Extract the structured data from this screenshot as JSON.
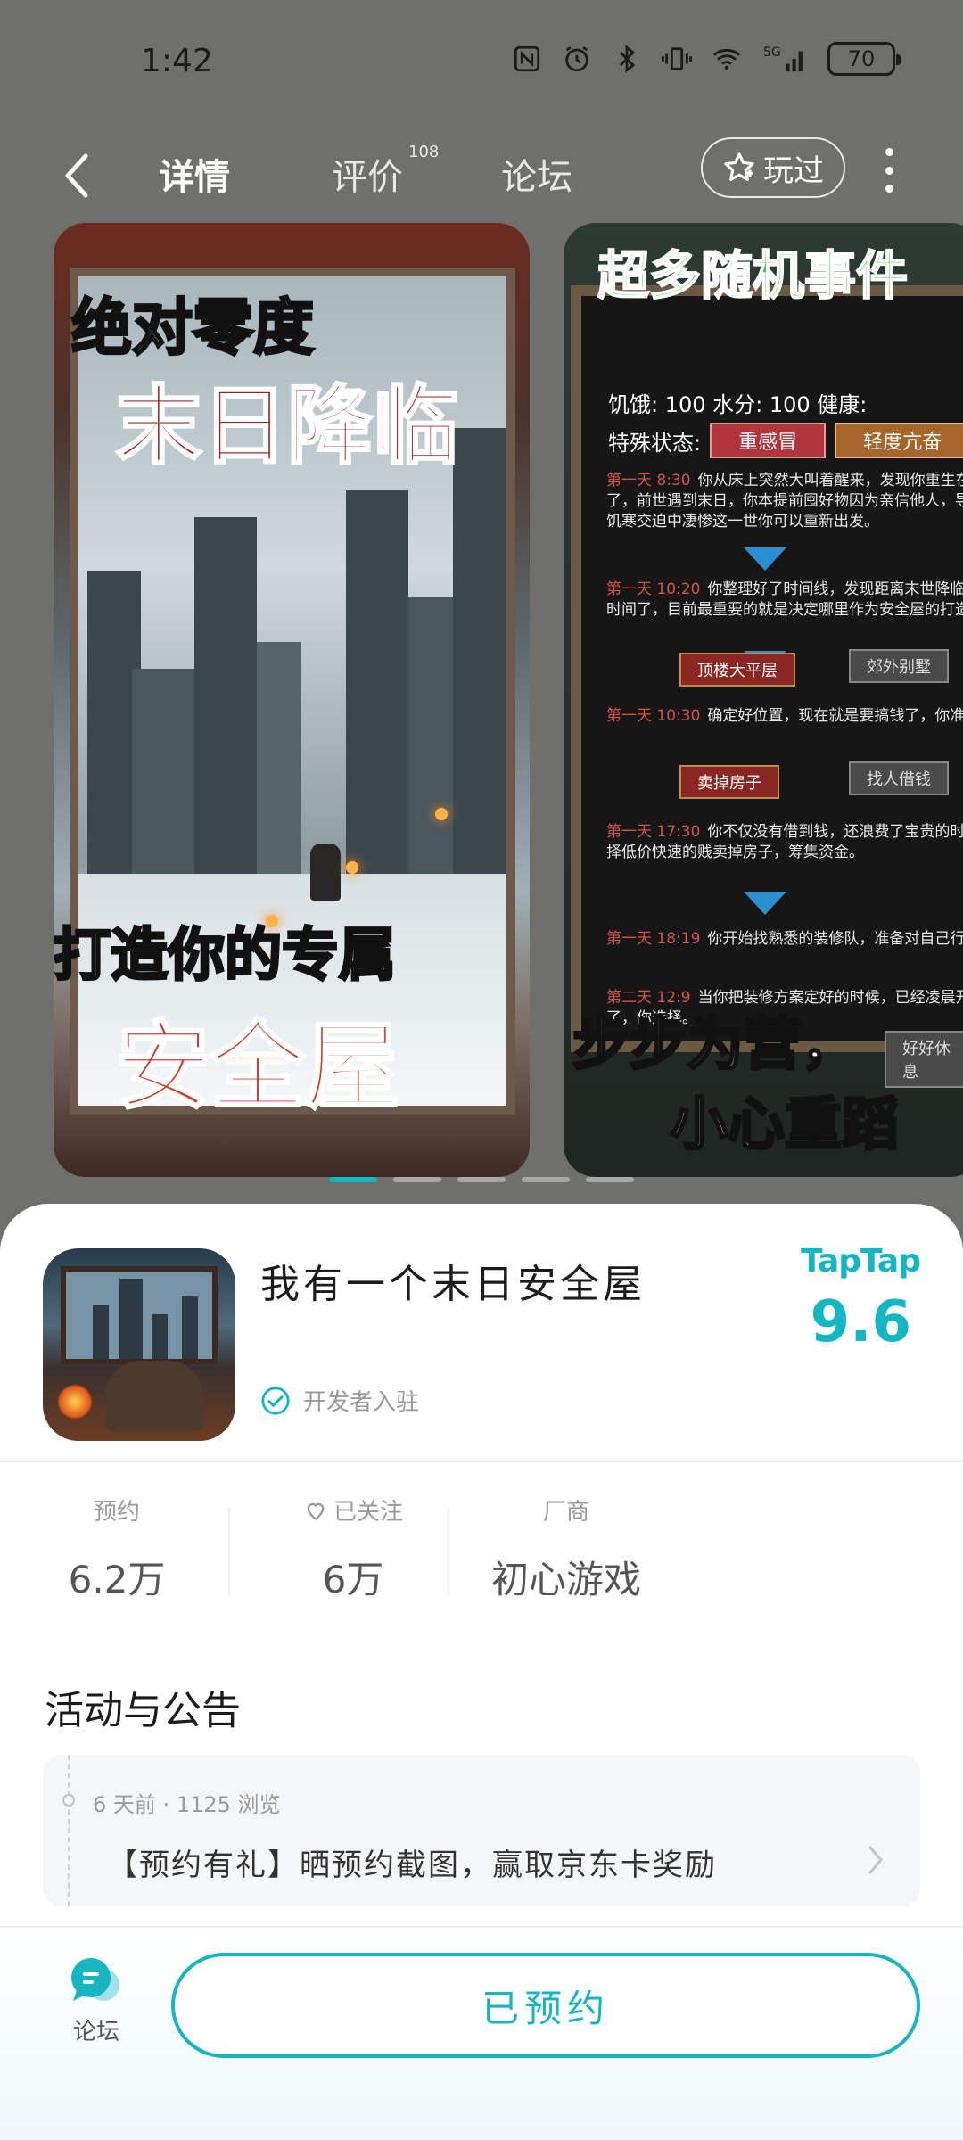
{
  "status_bar": {
    "time": "1:42",
    "network": "5G",
    "battery": "70"
  },
  "nav": {
    "tabs": [
      {
        "label": "详情",
        "active": true
      },
      {
        "label": "评价",
        "badge": "108"
      },
      {
        "label": "论坛"
      }
    ],
    "played_label": "玩过"
  },
  "screenshots": {
    "shot1": {
      "line1": "绝对零度",
      "line2": "末日降临",
      "line3": "打造你的专属",
      "line4": "安全屋"
    },
    "shot2": {
      "title": "超多随机事件",
      "stats": "饥饿: 100  水分: 100  健康:",
      "status_label": "特殊状态:",
      "status_chips": [
        "重感冒",
        "轻度亢奋"
      ],
      "events": [
        {
          "day": "第一天 8:30",
          "text": "你从床上突然大叫着醒来，发现你重生在以前了，前世遇到末日，你本提前囤好物因为亲信他人，导致你在饥寒交迫中凄惨这一世你可以重新出发。"
        },
        {
          "day": "第一天 10:20",
          "text": "你整理好了时间线，发现距离末世降临下一周时间了，目前最重要的就是决定哪里作为安全屋的打造低。"
        },
        {
          "day": "第一天 10:30",
          "text": "确定好位置，现在就是要搞钱了，你准搞钱。"
        },
        {
          "day": "第一天 17:30",
          "text": "你不仅没有借到钱，还浪费了宝贵的时只能选择低价快速的贱卖掉房子，筹集资金。"
        },
        {
          "day": "第一天 18:19",
          "text": "你开始找熟悉的装修队，准备对自己行改造。"
        },
        {
          "day": "第二天 12:9",
          "text": "当你把装修方案定好的时候，已经凌晨开始变冷了，你选择。"
        }
      ],
      "choices": [
        [
          "顶楼大平层",
          "郊外别墅"
        ],
        [
          "卖掉房子",
          "找人借钱"
        ],
        [
          "",
          "好好休息"
        ]
      ],
      "bottom_line1": "步步为营，",
      "bottom_line2": "小心重蹈"
    },
    "page_count": 5,
    "active_index": 0
  },
  "app": {
    "name": "我有一个末日安全屋",
    "developer_badge": "开发者入驻",
    "platform": "TapTap",
    "rating": "9.6"
  },
  "stats": [
    {
      "label": "预约",
      "value": "6.2万"
    },
    {
      "label": "已关注",
      "value": "6万"
    },
    {
      "label": "厂商",
      "value": "初心游戏"
    }
  ],
  "announcements": {
    "title": "活动与公告",
    "items": [
      {
        "meta": "6 天前 · 1125 浏览",
        "text": "【预约有礼】晒预约截图，赢取京东卡奖励"
      }
    ]
  },
  "bottom_bar": {
    "forum_label": "论坛",
    "reserve_button": "已预约"
  },
  "colors": {
    "accent": "#14b6c4",
    "header_bg": "#6f6f6c"
  }
}
